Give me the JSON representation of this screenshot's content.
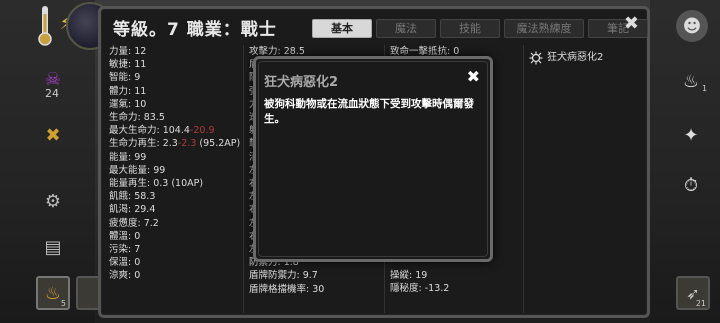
{
  "panel": {
    "title": "等級。7 職業：戰士",
    "tabs": [
      {
        "label": "基本",
        "active": true
      },
      {
        "label": "魔法",
        "active": false
      },
      {
        "label": "技能",
        "active": false
      },
      {
        "label": "魔法熟練度",
        "active": false
      },
      {
        "label": "筆記",
        "active": false
      }
    ],
    "close_label": "✖"
  },
  "stats_col1": [
    {
      "text": "力量: 12"
    },
    {
      "text": "敏捷: 11"
    },
    {
      "text": "智能: 9"
    },
    {
      "text": "體力: 11"
    },
    {
      "text": "運氣: 10"
    },
    {
      "text": "生命力: 83.5"
    },
    {
      "text": "最大生命力: 104.4",
      "neg": "-20.9"
    },
    {
      "text": "生命力再生: 2.3",
      "neg": "-2.3",
      "tail": " (95.2AP)"
    },
    {
      "text": "能量: 99"
    },
    {
      "text": "最大能量: 99"
    },
    {
      "text": "能量再生: 0.3 (10AP)"
    },
    {
      "text": "飢餓: 58.3"
    },
    {
      "text": "飢渴: 29.4"
    },
    {
      "text": "疲憊度: 7.2"
    },
    {
      "text": "體溫: 0"
    },
    {
      "text": "污染: 7"
    },
    {
      "text": "保溫: 0"
    },
    {
      "text": "涼爽: 0"
    }
  ],
  "stats_col2": [
    {
      "text": "攻擊力: 28.5"
    },
    {
      "text": "盾"
    },
    {
      "text": "防"
    },
    {
      "text": "強"
    },
    {
      "text": "力"
    },
    {
      "text": "速"
    },
    {
      "text": "躲"
    },
    {
      "text": "擊"
    },
    {
      "text": "消"
    },
    {
      "text": "左"
    },
    {
      "text": "右"
    },
    {
      "text": "左"
    },
    {
      "text": "右"
    },
    {
      "text": "左"
    },
    {
      "text": "右"
    },
    {
      "text": "左"
    },
    {
      "text": "防禦力: 1.8"
    },
    {
      "text": "盾牌防禦力: 9.7"
    },
    {
      "text": "盾牌格擋機率: 30"
    }
  ],
  "stats_col3": [
    {
      "text": "致命一擊抵抗: 0"
    },
    {
      "text": ""
    },
    {
      "text": ""
    },
    {
      "text": ""
    },
    {
      "text": ""
    },
    {
      "text": ""
    },
    {
      "text": ""
    },
    {
      "text": ""
    },
    {
      "text": ""
    },
    {
      "text": ""
    },
    {
      "text": ""
    },
    {
      "text": ""
    },
    {
      "text": ""
    },
    {
      "text": ""
    },
    {
      "text": ""
    },
    {
      "text": ""
    },
    {
      "text": "操縱: 19"
    },
    {
      "text": "隱秘度: -13.2"
    }
  ],
  "effects": [
    {
      "label": "狂犬病惡化2",
      "icon": "virus-icon"
    }
  ],
  "popup": {
    "title": "狂犬病惡化2",
    "close_label": "✖",
    "description": "被狗科動物或在流血狀態下受到攻擊時偶爾發生。"
  },
  "hud": {
    "left_counter": "24",
    "slot_count": "5",
    "right_counter_1": "1",
    "right_slot_count": "21"
  },
  "colors": {
    "panel_bg": "#1b1b1b",
    "negative": "#b03a3a",
    "tab_active": "#d8d8d8"
  }
}
